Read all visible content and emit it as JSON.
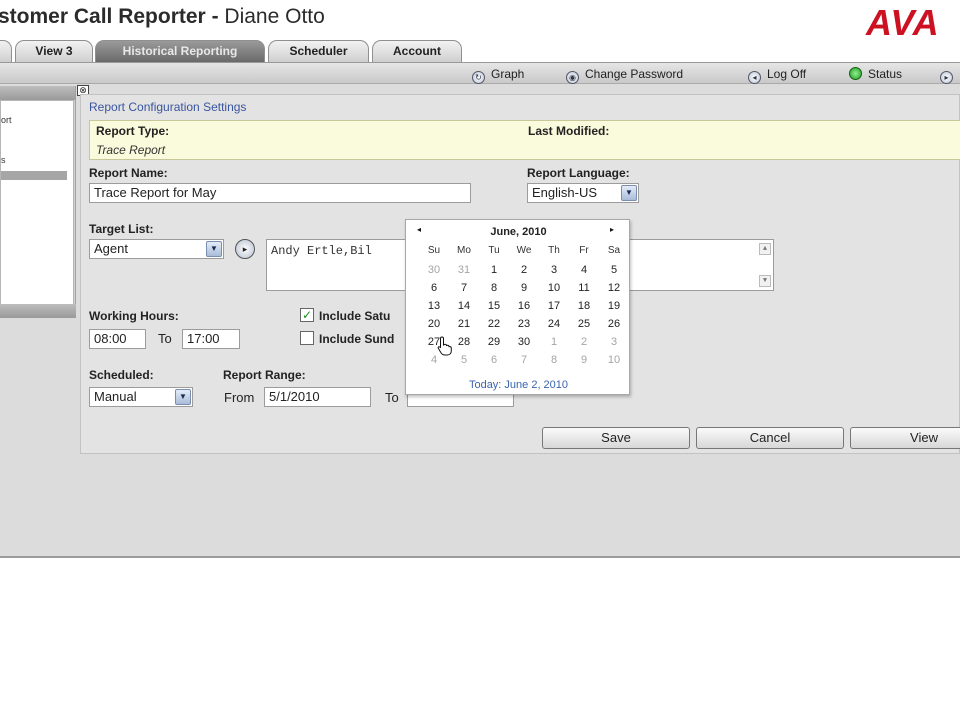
{
  "header": {
    "app_title": "stomer Call Reporter",
    "separator": " - ",
    "user_name": "Diane Otto",
    "logo_text": "AVA"
  },
  "tabs": [
    {
      "label": "View 3",
      "active": false
    },
    {
      "label": "Historical Reporting",
      "active": true
    },
    {
      "label": "Scheduler",
      "active": false
    },
    {
      "label": "Account",
      "active": false
    }
  ],
  "toolbar": {
    "graph": "Graph",
    "change_password": "Change Password",
    "log_off": "Log Off",
    "status": "Status"
  },
  "sidebar": {
    "item_1": "ort",
    "item_2": "s"
  },
  "form": {
    "section_title": "Report Configuration Settings",
    "report_type_label": "Report Type:",
    "report_type_value": "Trace Report",
    "last_modified_label": "Last Modified:",
    "report_name_label": "Report Name:",
    "report_name_value": "Trace Report for May",
    "report_language_label": "Report Language:",
    "report_language_value": "English-US",
    "target_list_label": "Target List:",
    "target_list_value": "Agent",
    "targets_text": "Andy Ertle,Bil",
    "working_hours_label": "Working Hours:",
    "working_from": "08:00",
    "to_label": "To",
    "working_to": "17:00",
    "include_saturday_label": "Include Satu",
    "include_sunday_label": "Include Sund",
    "scheduled_label": "Scheduled:",
    "scheduled_value": "Manual",
    "report_range_label": "Report Range:",
    "from_label": "From",
    "range_from": "5/1/2010",
    "range_to_label": "To"
  },
  "buttons": {
    "save": "Save",
    "cancel": "Cancel",
    "view": "View"
  },
  "calendar": {
    "prev": "◂",
    "next": "▸",
    "month": "June, 2010",
    "weekdays": [
      "Su",
      "Mo",
      "Tu",
      "We",
      "Th",
      "Fr",
      "Sa"
    ],
    "weeks": [
      [
        "30",
        "31",
        "1",
        "2",
        "3",
        "4",
        "5"
      ],
      [
        "6",
        "7",
        "8",
        "9",
        "10",
        "11",
        "12"
      ],
      [
        "13",
        "14",
        "15",
        "16",
        "17",
        "18",
        "19"
      ],
      [
        "20",
        "21",
        "22",
        "23",
        "24",
        "25",
        "26"
      ],
      [
        "27",
        "28",
        "29",
        "30",
        "1",
        "2",
        "3"
      ],
      [
        "4",
        "5",
        "6",
        "7",
        "8",
        "9",
        "10"
      ]
    ],
    "today": "Today: June 2, 2010"
  },
  "colors": {
    "logo_red": "#cc1122",
    "active_tab": "#7a7a7a",
    "link_blue": "#3a55a0",
    "highlight_yellow": "#fafadc"
  }
}
